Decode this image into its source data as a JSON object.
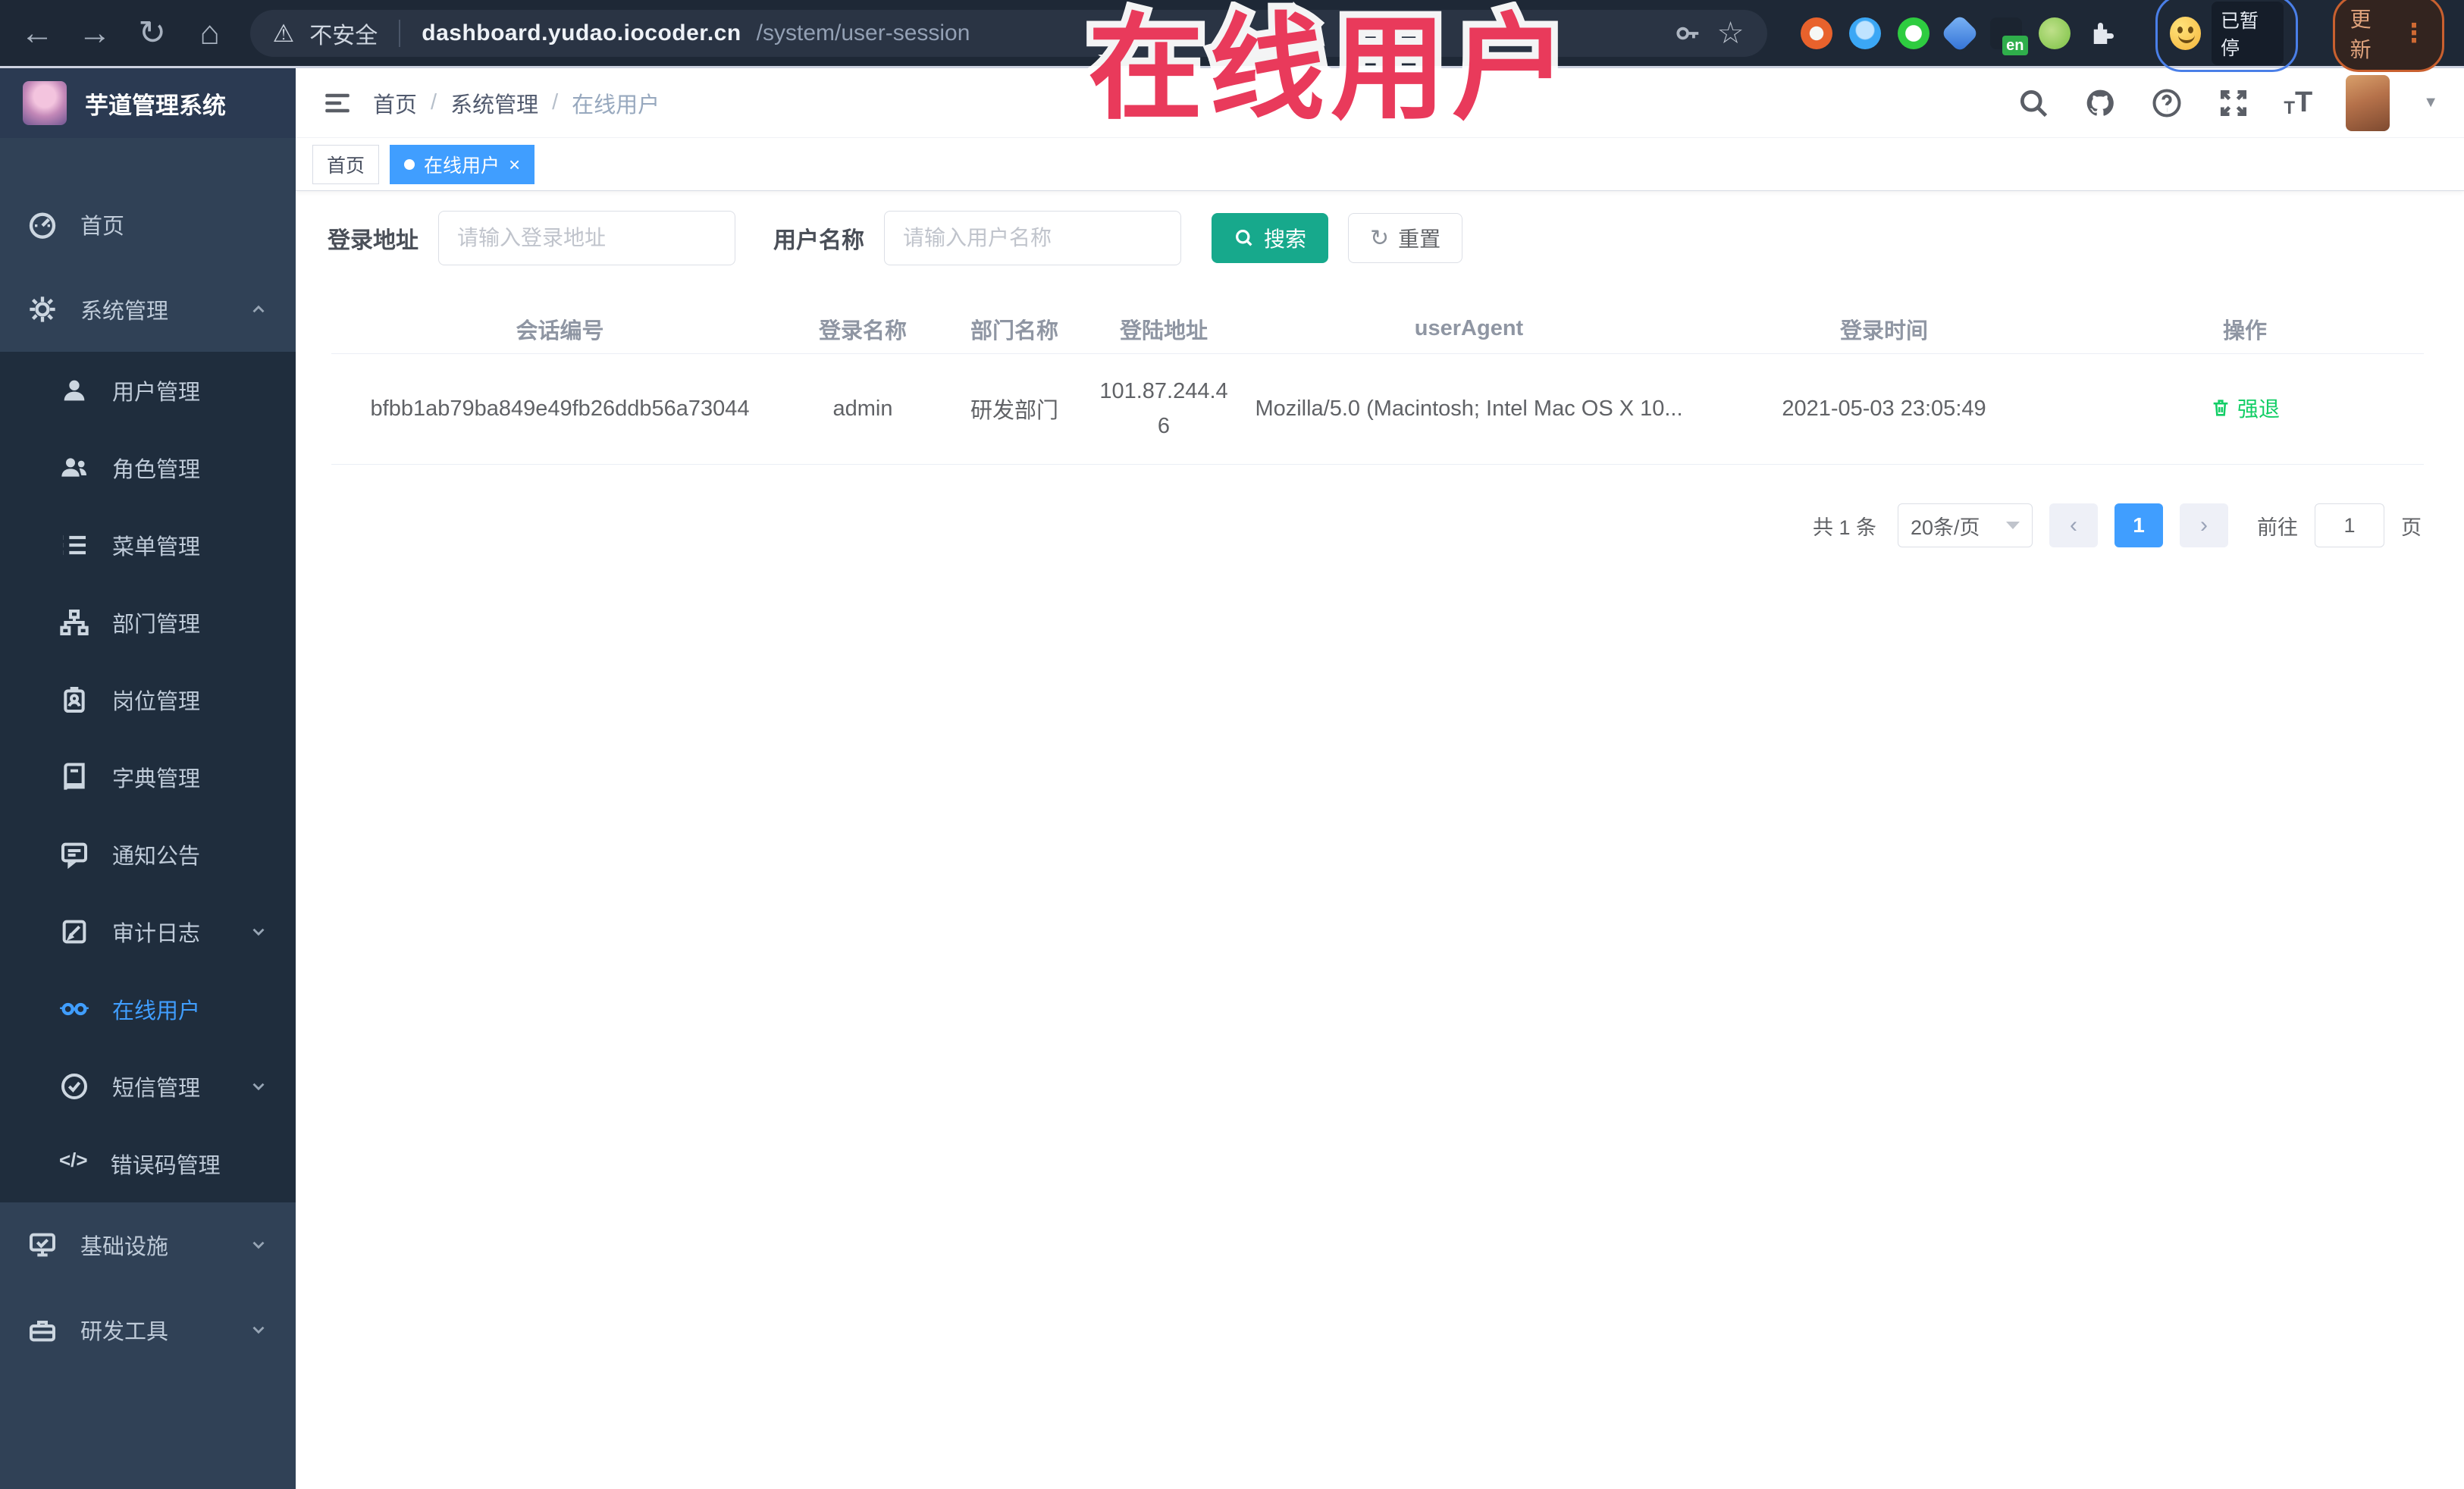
{
  "icons": {
    "back": "←",
    "forward": "→",
    "reload": "↻",
    "home": "⌂",
    "warning": "⚠",
    "star": "☆",
    "dots": "⋮",
    "close": "×",
    "question": "?",
    "caret_down": "▼",
    "prev": "‹",
    "next": "›",
    "errcode": "</>",
    "font_size": "T",
    "reset_glyph": "↻"
  },
  "browser": {
    "security_label": "不安全",
    "url_host": "dashboard.yudao.iocoder.cn",
    "url_path": "/system/user-session",
    "extension_en_badge": "en",
    "paused_label": "已暂停",
    "update_label": "更新"
  },
  "overlay": {
    "text": "在线用户"
  },
  "sidebar": {
    "title": "芋道管理系统",
    "top_items": [
      {
        "label": "首页"
      },
      {
        "label": "系统管理"
      }
    ],
    "submenu_items": [
      {
        "label": "用户管理"
      },
      {
        "label": "角色管理"
      },
      {
        "label": "菜单管理"
      },
      {
        "label": "部门管理"
      },
      {
        "label": "岗位管理"
      },
      {
        "label": "字典管理"
      },
      {
        "label": "通知公告"
      },
      {
        "label": "审计日志"
      },
      {
        "label": "在线用户"
      },
      {
        "label": "短信管理"
      },
      {
        "label": "错误码管理"
      }
    ],
    "bottom_items": [
      {
        "label": "基础设施"
      },
      {
        "label": "研发工具"
      }
    ]
  },
  "breadcrumb": {
    "items": [
      "首页",
      "系统管理",
      "在线用户"
    ],
    "separator": "/"
  },
  "tags": {
    "home": "首页",
    "active": "在线用户"
  },
  "filters": {
    "login_address_label": "登录地址",
    "login_address_placeholder": "请输入登录地址",
    "username_label": "用户名称",
    "username_placeholder": "请输入用户名称",
    "search_label": "搜索",
    "reset_label": "重置"
  },
  "table": {
    "columns": [
      "会话编号",
      "登录名称",
      "部门名称",
      "登陆地址",
      "userAgent",
      "登录时间",
      "操作"
    ],
    "row": {
      "session_id": "bfbb1ab79ba849e49fb26ddb56a73044",
      "login_name": "admin",
      "dept_name": "研发部门",
      "login_ip": "101.87.244.46",
      "user_agent": "Mozilla/5.0 (Macintosh; Intel Mac OS X 10...",
      "login_time": "2021-05-03 23:05:49",
      "action": "强退"
    }
  },
  "pagination": {
    "total": "共 1 条",
    "page_size": "20条/页",
    "current_page": "1",
    "goto_label": "前往",
    "goto_value": "1",
    "unit": "页"
  },
  "colors": {
    "accent": "#409EFF",
    "search_button": "#17A98C",
    "action_green": "#13CE66",
    "overlay_red": "#E93A5B",
    "sidebar_bg": "#304156",
    "submenu_bg": "#1F2D3D"
  }
}
